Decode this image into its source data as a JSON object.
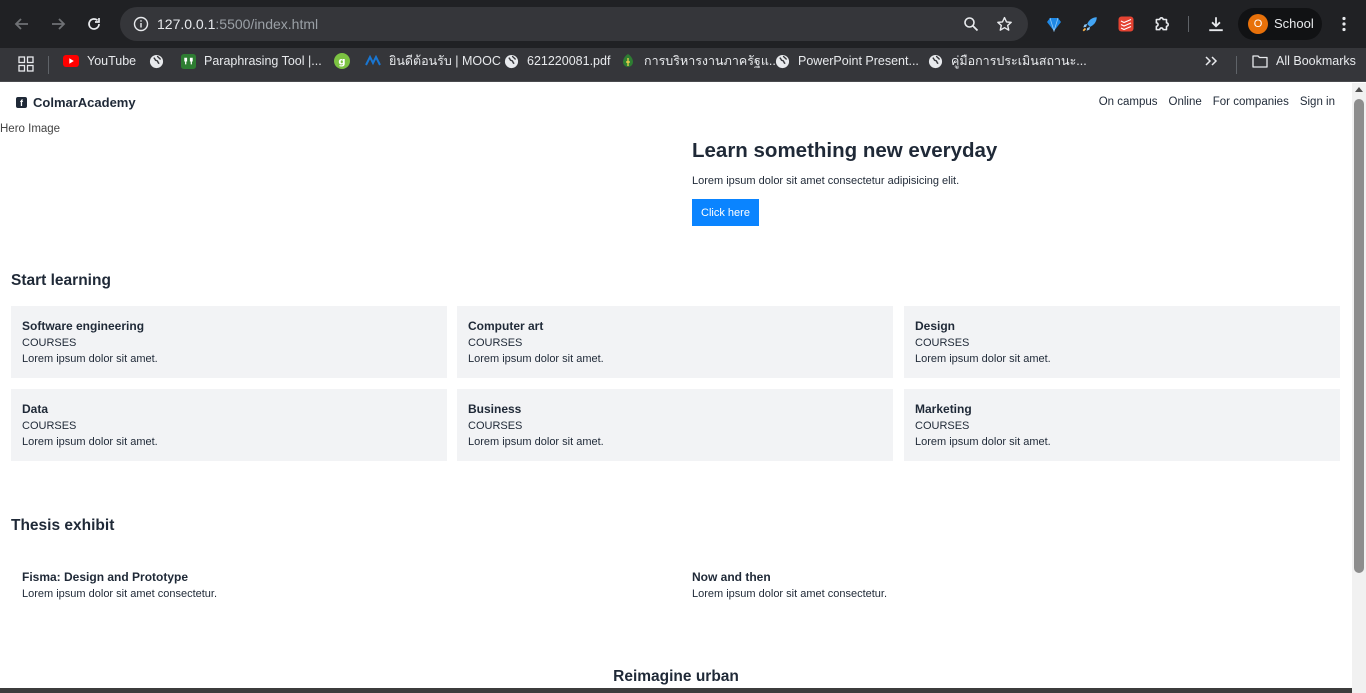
{
  "browser": {
    "url_host": "127.0.0.1",
    "url_rest": ":5500/index.html",
    "profile_initial": "O",
    "profile_name": "School",
    "bookmarks": [
      {
        "label": "YouTube",
        "icon": "youtube-icon"
      },
      {
        "label": "",
        "icon": "globe-icon"
      },
      {
        "label": "Paraphrasing Tool |...",
        "icon": "quillbot-icon"
      },
      {
        "label": "",
        "icon": "grammarly-icon"
      },
      {
        "label": "ยินดีต้อนรับ | MOOC",
        "icon": "mooc-icon"
      },
      {
        "label": "621220081.pdf",
        "icon": "globe-icon"
      },
      {
        "label": "การบริหารงานภาครัฐแ...",
        "icon": "university-icon"
      },
      {
        "label": "PowerPoint Present...",
        "icon": "globe-icon"
      },
      {
        "label": "คู่มือการประเมินสถานะ...",
        "icon": "globe-icon"
      }
    ],
    "all_bookmarks_label": "All Bookmarks"
  },
  "site": {
    "brand": "ColmarAcademy",
    "nav": [
      "On campus",
      "Online",
      "For companies",
      "Sign in"
    ],
    "hero": {
      "image_alt": "Hero Image",
      "title": "Learn something new everyday",
      "text": "Lorem ipsum dolor sit amet consectetur adipisicing elit.",
      "button": "Click here"
    },
    "start_learning": {
      "title": "Start learning",
      "cards": [
        {
          "title": "Software engineering",
          "subtitle": "COURSES",
          "desc": "Lorem ipsum dolor sit amet."
        },
        {
          "title": "Computer art",
          "subtitle": "COURSES",
          "desc": "Lorem ipsum dolor sit amet."
        },
        {
          "title": "Design",
          "subtitle": "COURSES",
          "desc": "Lorem ipsum dolor sit amet."
        },
        {
          "title": "Data",
          "subtitle": "COURSES",
          "desc": "Lorem ipsum dolor sit amet."
        },
        {
          "title": "Business",
          "subtitle": "COURSES",
          "desc": "Lorem ipsum dolor sit amet."
        },
        {
          "title": "Marketing",
          "subtitle": "COURSES",
          "desc": "Lorem ipsum dolor sit amet."
        }
      ]
    },
    "thesis": {
      "title": "Thesis exhibit",
      "items": [
        {
          "title": "Fisma: Design and Prototype",
          "desc": "Lorem ipsum dolor sit amet consectetur."
        },
        {
          "title": "Now and then",
          "desc": "Lorem ipsum dolor sit amet consectetur."
        }
      ]
    },
    "reimagine_title": "Reimagine urban"
  }
}
